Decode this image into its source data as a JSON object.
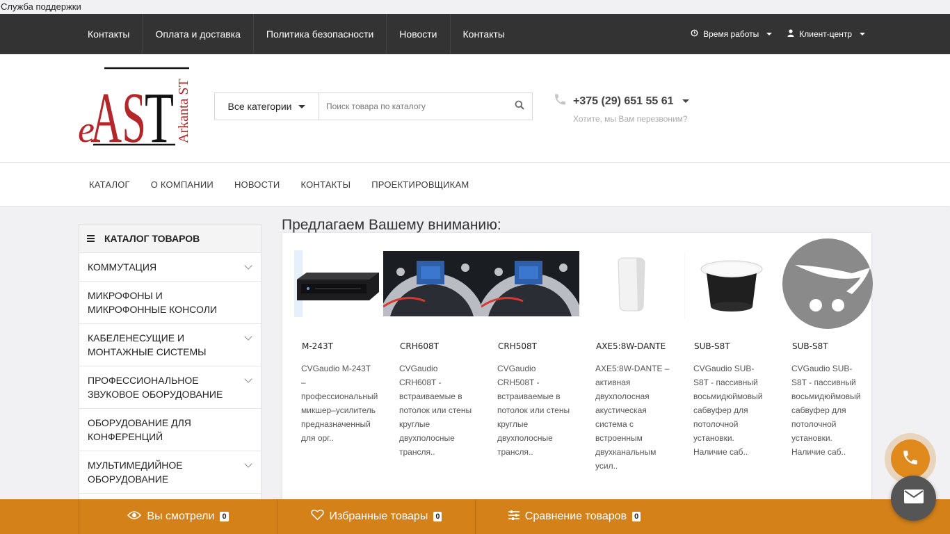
{
  "support_bar": {
    "label": "Служба поддержки"
  },
  "top_nav": {
    "links": [
      "Контакты",
      "Оплата и доставка",
      "Политика безопасности",
      "Новости",
      "Контакты"
    ],
    "work_hours": "Время работы",
    "client_center": "Клиент-центр"
  },
  "logo": {
    "initials": "AST",
    "prefix": "e",
    "brand_vertical": "Arkanta ST",
    "color": "#b3262a"
  },
  "search": {
    "category_label": "Все категории",
    "placeholder": "Поиск товара по каталогу"
  },
  "phone": {
    "number": "+375 (29) 651 55 61",
    "callback": "Хотите, мы Вам перезвоним?"
  },
  "main_nav": {
    "items": [
      "КАТАЛОГ",
      "О КОМПАНИИ",
      "НОВОСТИ",
      "КОНТАКТЫ",
      "ПРОЕКТИРОВЩИКАМ"
    ]
  },
  "sidebar": {
    "title": "КАТАЛОГ ТОВАРОВ",
    "items": [
      {
        "label": "КОММУТАЦИЯ",
        "has_children": true
      },
      {
        "label": "МИКРОФОНЫ И МИКРОФОННЫЕ КОНСОЛИ",
        "has_children": false
      },
      {
        "label": "КАБЕЛЕНЕСУЩИЕ И МОНТАЖНЫЕ СИСТЕМЫ",
        "has_children": true
      },
      {
        "label": "ПРОФЕССИОНАЛЬНОЕ ЗВУКОВОЕ ОБОРУДОВАНИЕ",
        "has_children": true
      },
      {
        "label": "ОБОРУДОВАНИЕ ДЛЯ КОНФЕРЕНЦИЙ",
        "has_children": false
      },
      {
        "label": "МУЛЬТИМЕДИЙНОЕ ОБОРУДОВАНИЕ",
        "has_children": true
      }
    ]
  },
  "offer": {
    "title": "Предлагаем Вашему вниманию:",
    "products": [
      {
        "name": "M-243T",
        "desc": "  CVGaudio M-243T – профессиональный микшер–усилитель предназначенный для орг..",
        "image": "mixer-amplifier"
      },
      {
        "name": "CRH608T",
        "desc": "  CVGaudio CRH608T -  встраиваемые в потолок или стены круглые двухполосные трансля..",
        "image": "ceiling-speaker-closeup"
      },
      {
        "name": "CRH508T",
        "desc": "  CVGaudio CRH508T -  встраиваемые в потолок или стены круглые двухполосные трансля..",
        "image": "ceiling-speaker-closeup"
      },
      {
        "name": "AXE5:8W-DANTE",
        "desc": "AXE5:8W-DANTE –  активная двухполосная акустическая система с встроенным двухканальным усил..",
        "image": "wall-speaker"
      },
      {
        "name": "SUB-S8T",
        "desc": "CVGaudio SUB-S8T - пассивный восьмидюймовый сабвуфер для потолочной установки. Наличие саб..",
        "image": "ceiling-subwoofer"
      },
      {
        "name": "SUB-S8T",
        "desc": "CVGaudio SUB-S8T - пассивный восьмидюймовый сабвуфер для потолочной установки. Наличие саб..",
        "image": "no-image-placeholder"
      }
    ]
  },
  "bottom_bar": {
    "viewed": {
      "label": "Вы смотрели",
      "count": "0"
    },
    "favorites": {
      "label": "Избранные товары",
      "count": "0"
    },
    "compare": {
      "label": "Сравнение товаров",
      "count": "0"
    }
  },
  "colors": {
    "accent": "#d4811a",
    "topbar": "#333333"
  }
}
